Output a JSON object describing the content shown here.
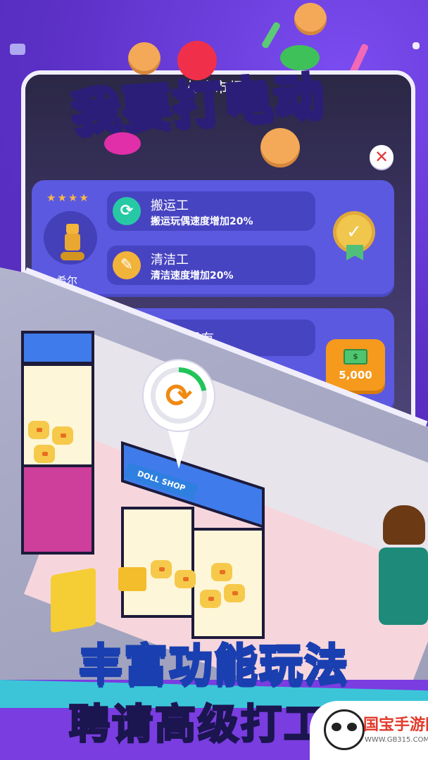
{
  "game_title": "我要打电动",
  "dialog": {
    "title": "人才市场",
    "close_icon": "close-icon",
    "worker": {
      "stars": "★★★★",
      "name": "希尔",
      "skills": [
        {
          "icon": "refresh-icon",
          "name": "搬运工",
          "desc": "搬运玩偶速度增加20%"
        },
        {
          "icon": "broom-icon",
          "name": "清洁工",
          "desc": "清洁速度增加20%"
        }
      ],
      "badge_icon": "check-badge-icon"
    },
    "worker2": {
      "desc_visible": "什么特长也没有",
      "price": "5,000",
      "price_icon": "cash-icon"
    }
  },
  "scene": {
    "machine_sign": "DOLL SHOP",
    "progress": 0.22,
    "progress_icon": "refresh-icon"
  },
  "banner_top": "丰富功能玩法",
  "banner_bottom": "聘请高级打工人",
  "watermark": {
    "name": "国宝手游网",
    "url": "WWW.GB315.COM"
  },
  "colors": {
    "background": "#6a3fd8",
    "card": "#5b59e0",
    "price_button": "#f59a1c",
    "accent_green": "#27c9a5"
  }
}
